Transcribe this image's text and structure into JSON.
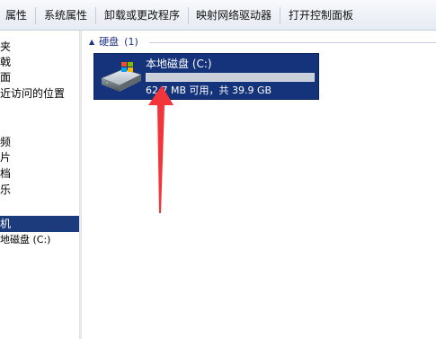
{
  "toolbar": {
    "items": [
      "属性",
      "系统属性",
      "卸载或更改程序",
      "映射网络驱动器",
      "打开控制面板"
    ]
  },
  "nav": {
    "items": [
      {
        "label": "夹"
      },
      {
        "label": "戟"
      },
      {
        "label": "面"
      },
      {
        "label": "近访问的位置"
      },
      {
        "label": "频"
      },
      {
        "label": "片"
      },
      {
        "label": "档"
      },
      {
        "label": "乐"
      },
      {
        "label": "机"
      },
      {
        "label": "地磁盘 (C:)"
      }
    ]
  },
  "content": {
    "group": {
      "title": "硬盘",
      "count": "(1)"
    },
    "drive": {
      "name": "本地磁盘 (C:)",
      "space_text": "62.7 MB 可用，共 39.9 GB",
      "used_fraction": 0.998
    }
  },
  "colors": {
    "selection": "#14337a",
    "annotation_arrow": "#f2353b",
    "group_header": "#1e3287"
  }
}
